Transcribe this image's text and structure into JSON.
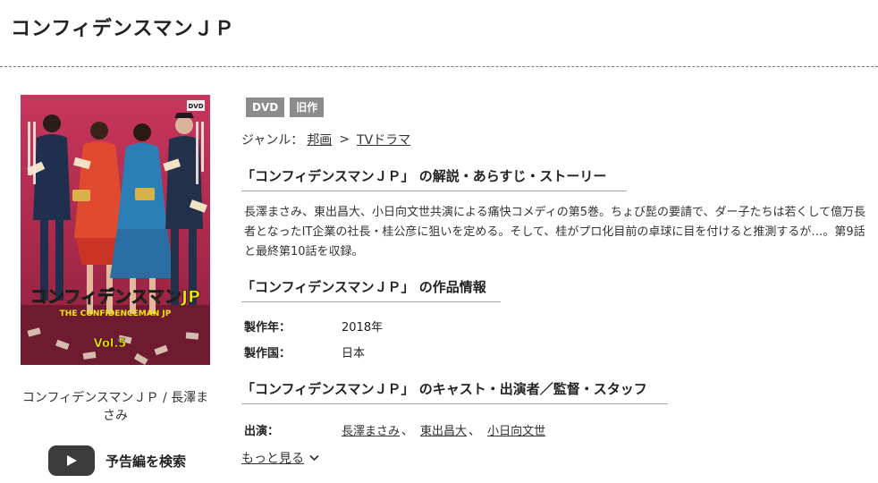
{
  "page": {
    "title": "コンフィデンスマンＪＰ"
  },
  "cover": {
    "caption": "コンフィデンスマンＪＰ / 長澤まさみ",
    "logo_line1": "コンフィデンスマンJP",
    "logo_line2": "THE CONFIDENCEMAN JP",
    "volume": "Vol.5",
    "dvd_mark": "DVD"
  },
  "trailer": {
    "label": "予告編を検索",
    "icon": "play-icon"
  },
  "badges": [
    "DVD",
    "旧作"
  ],
  "genre": {
    "label": "ジャンル：",
    "items": [
      "邦画",
      "TVドラマ"
    ],
    "separator": ">"
  },
  "sections": {
    "synopsis_heading": "「コンフィデンスマンＪＰ」 の解説・あらすじ・ストーリー",
    "synopsis_text": "長澤まさみ、東出昌大、小日向文世共演による痛快コメディの第5巻。ちょび髭の要請で、ダー子たちは若くして億万長者となったIT企業の社長・桂公彦に狙いを定める。そして、桂がプロ化目前の卓球に目を付けると推測するが…。第9話と最終第10話を収録。",
    "info_heading": "「コンフィデンスマンＪＰ」 の作品情報",
    "cast_heading": "「コンフィデンスマンＪＰ」 のキャスト・出演者／監督・スタッフ"
  },
  "info": {
    "year_label": "製作年：",
    "year_value": "2018年",
    "country_label": "製作国：",
    "country_value": "日本"
  },
  "cast": {
    "label": "出演：",
    "names": [
      "長澤まさみ",
      "東出昌大",
      "小日向文世"
    ],
    "separator": "、"
  },
  "more": {
    "label": "もっと見る",
    "icon": "chevron-down-icon"
  },
  "colors": {
    "badge_bg": "#8c8c8c",
    "play_button": "#3b3b3b",
    "cover_background": "#b42a52",
    "logo_yellow": "#f2e600"
  }
}
